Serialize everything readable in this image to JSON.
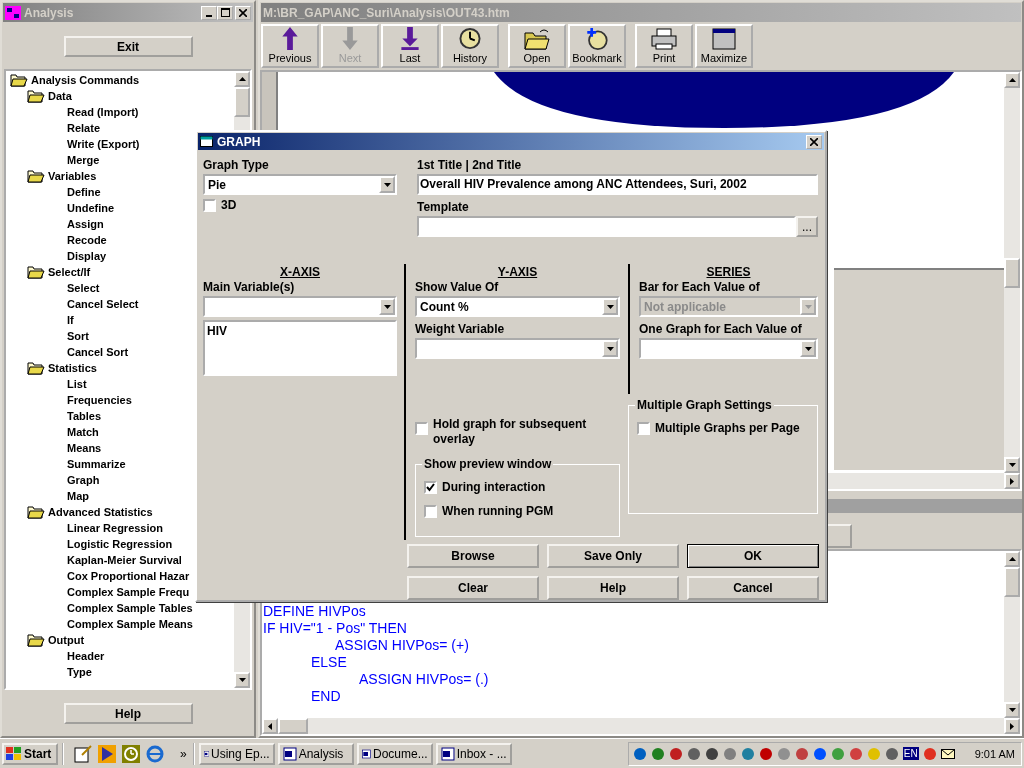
{
  "analysis_window": {
    "title": "Analysis",
    "exit_button": "Exit",
    "help_button": "Help",
    "tree": {
      "label": "Analysis Commands",
      "expanded": true,
      "children": [
        {
          "label": "Data",
          "expanded": true,
          "children": [
            {
              "label": "Read (Import)"
            },
            {
              "label": "Relate"
            },
            {
              "label": "Write (Export)"
            },
            {
              "label": "Merge"
            }
          ]
        },
        {
          "label": "Variables",
          "expanded": true,
          "children": [
            {
              "label": "Define"
            },
            {
              "label": "Undefine"
            },
            {
              "label": "Assign"
            },
            {
              "label": "Recode"
            },
            {
              "label": "Display"
            }
          ]
        },
        {
          "label": "Select/If",
          "expanded": true,
          "children": [
            {
              "label": "Select"
            },
            {
              "label": "Cancel Select"
            },
            {
              "label": "If"
            },
            {
              "label": "Sort"
            },
            {
              "label": "Cancel Sort"
            }
          ]
        },
        {
          "label": "Statistics",
          "expanded": true,
          "children": [
            {
              "label": "List"
            },
            {
              "label": "Frequencies"
            },
            {
              "label": "Tables"
            },
            {
              "label": "Match"
            },
            {
              "label": "Means"
            },
            {
              "label": "Summarize"
            },
            {
              "label": "Graph"
            },
            {
              "label": "Map"
            }
          ]
        },
        {
          "label": "Advanced Statistics",
          "expanded": true,
          "children": [
            {
              "label": "Linear Regression"
            },
            {
              "label": "Logistic Regression"
            },
            {
              "label": "Kaplan-Meier Survival"
            },
            {
              "label": "Cox Proportional Hazar"
            },
            {
              "label": "Complex Sample Frequ"
            },
            {
              "label": "Complex Sample Tables"
            },
            {
              "label": "Complex Sample Means"
            }
          ]
        },
        {
          "label": "Output",
          "expanded": true,
          "children": [
            {
              "label": "Header"
            },
            {
              "label": "Type"
            }
          ]
        }
      ]
    }
  },
  "output_window": {
    "title": "M:\\BR_GAP\\ANC_Suri\\Analysis\\OUT43.htm",
    "toolbar_groups": [
      {
        "buttons": [
          {
            "label": "Previous",
            "kind": "previous",
            "disabled": false
          },
          {
            "label": "Next",
            "kind": "next",
            "disabled": true
          },
          {
            "label": "Last",
            "kind": "last",
            "disabled": false
          },
          {
            "label": "History",
            "kind": "history",
            "disabled": false
          }
        ]
      },
      {
        "buttons": [
          {
            "label": "Open",
            "kind": "open",
            "disabled": false
          },
          {
            "label": "Bookmark",
            "kind": "bookmark",
            "disabled": false
          }
        ]
      },
      {
        "buttons": [
          {
            "label": "Print",
            "kind": "print",
            "disabled": false
          },
          {
            "label": "Maximize",
            "kind": "maximize",
            "disabled": false
          }
        ]
      }
    ]
  },
  "program_editor": {
    "lines": [
      "DEFINE HIVPos",
      "IF HIV=\"1 - Pos\" THEN",
      "\t\t\tASSIGN HIVPos= (+)",
      "\t\tELSE",
      "\t\t\t\tASSIGN HIVPos= (.)",
      "\t\tEND"
    ]
  },
  "graph_dialog": {
    "title": "GRAPH",
    "graph_type": {
      "label": "Graph Type",
      "value": "Pie"
    },
    "three_d": {
      "label": "3D",
      "checked": false
    },
    "titles": {
      "label": "1st Title | 2nd Title",
      "value": "Overall HIV Prevalence among ANC Attendees, Suri, 2002"
    },
    "template": {
      "label": "Template",
      "browse": "..."
    },
    "x_axis": {
      "heading": "X-AXIS",
      "label": "Main Variable(s)",
      "list": [
        "HIV"
      ]
    },
    "y_axis": {
      "heading": "Y-AXIS",
      "show_value": {
        "label": "Show Value Of",
        "value": "Count %"
      },
      "weight": {
        "label": "Weight Variable"
      }
    },
    "series": {
      "heading": "SERIES",
      "bar_for_each": {
        "label": "Bar for Each Value of",
        "value": "Not applicable",
        "disabled": true
      },
      "one_graph_for_each": {
        "label": "One Graph for Each Value of"
      }
    },
    "hold_graph": {
      "label": "Hold graph for subsequent overlay",
      "checked": false
    },
    "preview": {
      "label": "Show preview window",
      "options": [
        {
          "label": "During interaction",
          "checked": true
        },
        {
          "label": "When running PGM",
          "checked": false
        }
      ]
    },
    "multiple": {
      "label": "Multiple Graph Settings",
      "options": [
        {
          "label": "Multiple Graphs per Page",
          "checked": false
        }
      ]
    },
    "buttons": [
      {
        "label": "Browse",
        "default": false
      },
      {
        "label": "Save Only",
        "default": false
      },
      {
        "label": "OK",
        "default": true
      },
      {
        "label": "Clear",
        "default": false
      },
      {
        "label": "Help",
        "default": false
      },
      {
        "label": "Cancel",
        "default": false
      }
    ]
  },
  "taskbar": {
    "start": "Start",
    "more": "»",
    "tasks": [
      {
        "label": "Using Ep..."
      },
      {
        "label": "Analysis"
      },
      {
        "label": "Docume..."
      },
      {
        "label": "Inbox - ..."
      }
    ],
    "language": "EN",
    "clock": "9:01 AM"
  }
}
